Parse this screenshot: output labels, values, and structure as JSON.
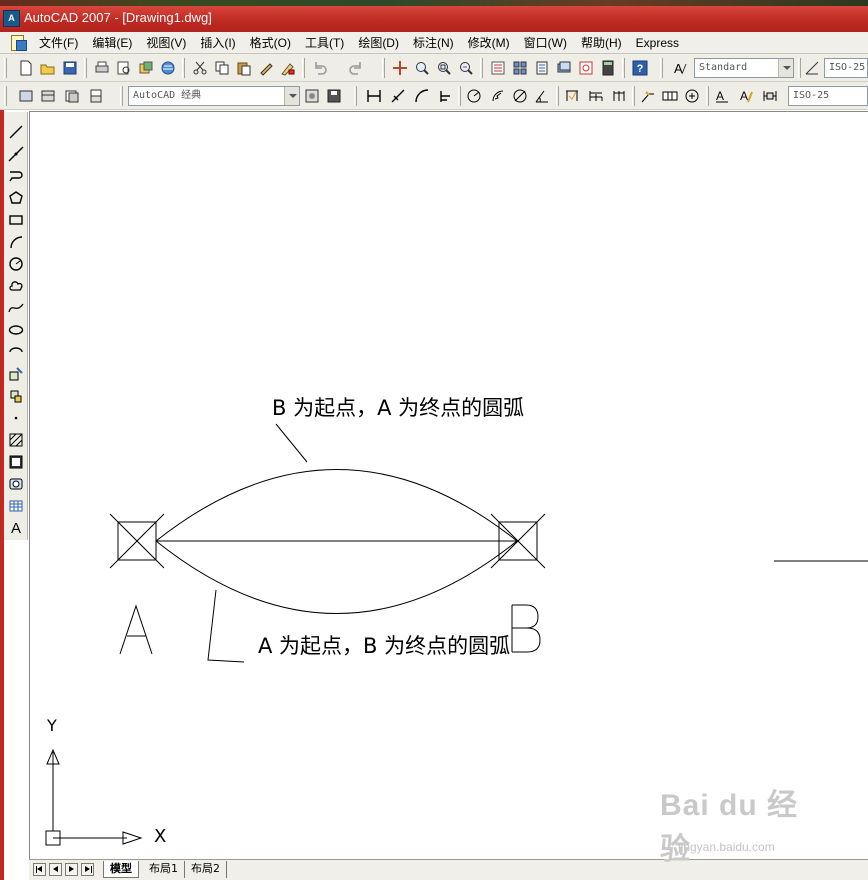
{
  "window": {
    "title": "AutoCAD 2007 - [Drawing1.dwg]",
    "app_icon": "autocad-icon"
  },
  "menu": {
    "items": [
      "文件(F)",
      "编辑(E)",
      "视图(V)",
      "插入(I)",
      "格式(O)",
      "工具(T)",
      "绘图(D)",
      "标注(N)",
      "修改(M)",
      "窗口(W)",
      "帮助(H)",
      "Express"
    ]
  },
  "toolbar": {
    "text_style": "Standard",
    "dim_style": "ISO-25",
    "workspace": "AutoCAD 经典",
    "dim_style_2": "ISO-25"
  },
  "drawing": {
    "label_top": "B 为起点，A 为终点的圆弧",
    "label_bottom": "A 为起点，B 为终点的圆弧",
    "point_a": "A",
    "point_b": "B",
    "ucs_x": "X",
    "ucs_y": "Y"
  },
  "layout_tabs": [
    "模型",
    "布局1",
    "布局2"
  ],
  "watermark": {
    "title": "Bai du 经验",
    "url": "jingyan.baidu.com"
  }
}
